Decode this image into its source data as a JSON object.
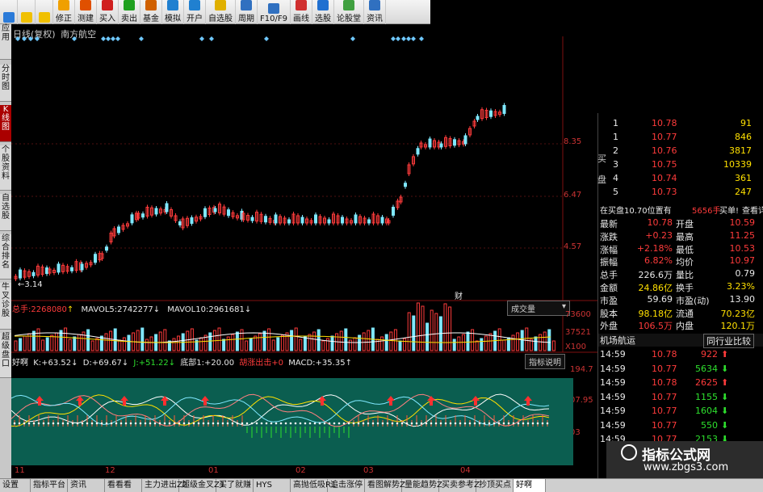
{
  "toolbar": {
    "items": [
      {
        "label": "",
        "icon": "refresh-icon"
      },
      {
        "label": "",
        "icon": "back-arrow-icon"
      },
      {
        "label": "",
        "icon": "forward-arrow-icon"
      },
      {
        "label": "修正",
        "icon": "down-arrow-icon"
      },
      {
        "label": "测建",
        "icon": "lightning-icon"
      },
      {
        "label": "买入",
        "icon": "buy-icon"
      },
      {
        "label": "卖出",
        "icon": "sell-icon"
      },
      {
        "label": "基金",
        "icon": "fund-icon"
      },
      {
        "label": "模拟",
        "icon": "simulate-icon"
      },
      {
        "label": "开户",
        "icon": "account-icon"
      },
      {
        "label": "自选股",
        "icon": "star-icon"
      },
      {
        "label": "周期",
        "icon": "clock-icon"
      },
      {
        "label": "F10/F9",
        "icon": "f10-icon"
      },
      {
        "label": "画线",
        "icon": "pen-icon"
      },
      {
        "label": "选股",
        "icon": "filter-icon"
      },
      {
        "label": "论股堂",
        "icon": "forum-icon"
      },
      {
        "label": "资讯",
        "icon": "news-icon"
      }
    ]
  },
  "left_tabs": [
    "应用",
    "分时图",
    "K线图",
    "个股资料",
    "自选股",
    "综合排名",
    "牛叉诊股",
    "超级盘口"
  ],
  "chart": {
    "title": "日线(复权)",
    "stock_name": "南方航空",
    "price_labels": [
      "8.35",
      "6.47",
      "4.57"
    ],
    "low_mark": "3.14",
    "cai_label": "财"
  },
  "volume": {
    "total_label": "总手:",
    "total_value": "2268080",
    "ma5_label": "MAVOL5:",
    "ma5_value": "2742277",
    "ma10_label": "MAVOL10:",
    "ma10_value": "2961681",
    "dropdown_label": "成交量",
    "axis": [
      "73600",
      "37521",
      "X100"
    ]
  },
  "kdj": {
    "name": "好啊",
    "k_label": "K:",
    "k_value": "+63.52",
    "d_label": "D:",
    "d_value": "+69.67",
    "j_label": "J:",
    "j_value": "+51.22",
    "low_label": "底部1:",
    "low_value": "+20.00",
    "signal_label": "胡涨出击",
    "signal_value": "+0",
    "macd_label": "MACD:",
    "macd_value": "+35.35",
    "button": "指标说明",
    "axis": [
      "194.7",
      "07.95",
      "03"
    ]
  },
  "dates": [
    "11",
    "12",
    "01",
    "02",
    "03",
    "04"
  ],
  "bottom_tabs": [
    "设置",
    "指标平台",
    "资讯",
    "看看看",
    "主力进出Z2",
    "超级金叉Z1",
    "买了就赚",
    "HYS",
    "高抛低吸R1",
    "追击涨停",
    "看图解势Z",
    "量能趋势Z",
    "买卖参考Z",
    "抄顶买点",
    "好啊"
  ],
  "order_book": {
    "side_label": "买盘",
    "rows": [
      {
        "level": "1",
        "price": "10.78",
        "vol": "91"
      },
      {
        "level": "1",
        "price": "10.77",
        "vol": "846"
      },
      {
        "level": "2",
        "price": "10.76",
        "vol": "3817"
      },
      {
        "level": "3",
        "price": "10.75",
        "vol": "10339"
      },
      {
        "level": "4",
        "price": "10.74",
        "vol": "361"
      },
      {
        "level": "5",
        "price": "10.73",
        "vol": "247"
      }
    ],
    "summary_text": "在买盘10.70位置有",
    "summary_vol": "5656手",
    "summary_side": "买单!",
    "summary_link": "查看详细"
  },
  "quote_stats": [
    {
      "l1": "最新",
      "v1": "10.78",
      "l2": "开盘",
      "v2": "10.59"
    },
    {
      "l1": "涨跌",
      "v1": "+0.23",
      "l2": "最高",
      "v2": "11.25"
    },
    {
      "l1": "涨幅",
      "v1": "+2.18%",
      "l2": "最低",
      "v2": "10.53"
    },
    {
      "l1": "振幅",
      "v1": "6.82%",
      "l2": "均价",
      "v2": "10.97"
    },
    {
      "l1": "总手",
      "v1": "226.6万",
      "l2": "量比",
      "v2": "0.79"
    },
    {
      "l1": "金额",
      "v1": "24.86亿",
      "l2": "换手",
      "v2": "3.23%"
    },
    {
      "l1": "市盈",
      "v1": "59.69",
      "l2": "市盈(动)",
      "v2": "13.90"
    },
    {
      "l1": "股本",
      "v1": "98.18亿",
      "l2": "流通",
      "v2": "70.23亿"
    },
    {
      "l1": "外盘",
      "v1": "106.5万",
      "l2": "内盘",
      "v2": "120.1万"
    }
  ],
  "sector": {
    "name": "机场航运",
    "button": "同行业比较"
  },
  "ticks": [
    {
      "time": "14:59",
      "price": "10.78",
      "vol": "922",
      "dir": "up"
    },
    {
      "time": "14:59",
      "price": "10.77",
      "vol": "5634",
      "dir": "down"
    },
    {
      "time": "14:59",
      "price": "10.78",
      "vol": "2625",
      "dir": "up"
    },
    {
      "time": "14:59",
      "price": "10.77",
      "vol": "1155",
      "dir": "down"
    },
    {
      "time": "14:59",
      "price": "10.77",
      "vol": "1604",
      "dir": "down"
    },
    {
      "time": "14:59",
      "price": "10.77",
      "vol": "550",
      "dir": "down"
    },
    {
      "time": "14:59",
      "price": "10.77",
      "vol": "2153",
      "dir": "down"
    }
  ],
  "watermark": {
    "title": "指标公式网",
    "url": "www.zbgs3.com"
  },
  "colors": {
    "up": "#ff3b3b",
    "down": "#2ee02e",
    "cyan": "#7fe8ff",
    "panel": "#0b5e50"
  }
}
